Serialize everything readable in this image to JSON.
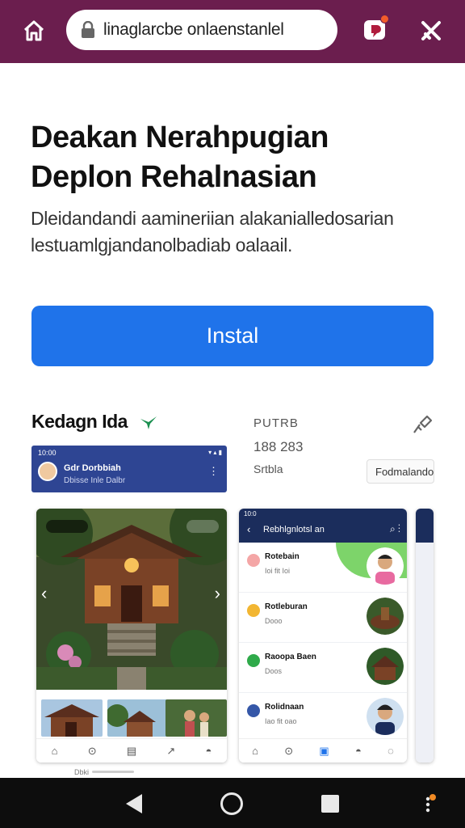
{
  "browser": {
    "url": "linaglarcbe onlaenstanlel",
    "extension_badge_color": "#f25c2a",
    "bar_color": "#6b1e4e",
    "icons": [
      "home-icon",
      "lock-icon",
      "extension-icon",
      "close-icon"
    ]
  },
  "app": {
    "title": "Deakan Nerahpugian Deplon Rehalnasian",
    "description": "Dleidandandi aamineriian alakanialledosarian lestuamlgjandanolbadiab oalaail.",
    "install_label": "Instal",
    "accent_color": "#1f73ea"
  },
  "details": {
    "section_title": "Kedagn Ida",
    "developer": "PUTRB",
    "count": "188 283",
    "category": "Srtbla",
    "tag_label": "Fodmalandol"
  },
  "banner": {
    "name": "Gdr Dorbbiah",
    "subtitle": "Dbisse Inle Dalbr"
  },
  "screenshot1": {
    "nav_icons": [
      "home-icon",
      "pin-icon",
      "book-icon",
      "share-icon",
      "profile-icon"
    ]
  },
  "screenshot2": {
    "header_title": "Rebhlgnlotsl an",
    "rows": [
      {
        "title": "Rotebain",
        "subtitle": "Ioi fit Ioi",
        "icon_color": "#f4a6a6"
      },
      {
        "title": "Rotleburan",
        "subtitle": "Dooo",
        "icon_color": "#f2b632"
      },
      {
        "title": "Raoopa Baen",
        "subtitle": "Doos",
        "icon_color": "#2faa4a"
      },
      {
        "title": "Rolidnaan",
        "subtitle": "Iao fit oao",
        "icon_color": "#3557a8"
      }
    ]
  },
  "caption": "Dbki",
  "system_nav": [
    "back-icon",
    "home-circle-icon",
    "recents-icon",
    "more-icon"
  ]
}
